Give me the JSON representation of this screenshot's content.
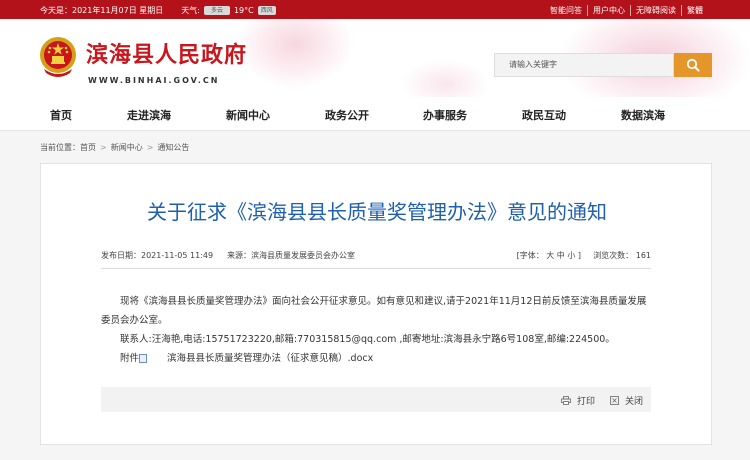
{
  "topbar": {
    "date": "今天是：2021年11月07日 星期日",
    "weather_label": "天气:",
    "weather_now": "多云",
    "temperature": "19°C",
    "weather_wind": "西风",
    "links": [
      "智能问答",
      "用户中心",
      "无障碍阅读",
      "繁體"
    ]
  },
  "header": {
    "title": "滨海县人民政府",
    "url": "WWW.BINHAI.GOV.CN",
    "search_placeholder": "请输入关键字"
  },
  "nav": [
    "首页",
    "走进滨海",
    "新闻中心",
    "政务公开",
    "办事服务",
    "政民互动",
    "数据滨海"
  ],
  "breadcrumb": {
    "label": "当前位置：",
    "items": [
      "首页",
      "新闻中心",
      "通知公告"
    ]
  },
  "article": {
    "title": "关于征求《滨海县县长质量奖管理办法》意见的通知",
    "date": "发布日期：2021-11-05 11:49",
    "source": "来源：滨海县质量发展委员会办公室",
    "font_size": "[字体：  大  中  小 ]",
    "views": "浏览次数： 161",
    "paragraphs": [
      "现将《滨海县县长质量奖管理办法》面向社会公开征求意见。如有意见和建议,请于2021年11月12日前反馈至滨海县质量发展委员会办公室。",
      "联系人:汪海艳,电话:15751723220,邮箱:770315815@qq.com ,邮寄地址:滨海县永宁路6号108室,邮编:224500。"
    ],
    "attachment_label": "附件",
    "attachment_name": "滨海县县长质量奖管理办法（征求意见稿）.docx",
    "print_label": "打印",
    "close_label": "关闭"
  },
  "colors": {
    "brand_red": "#b4121a",
    "title_blue": "#1f5fb0",
    "search_orange": "#e5962b"
  }
}
